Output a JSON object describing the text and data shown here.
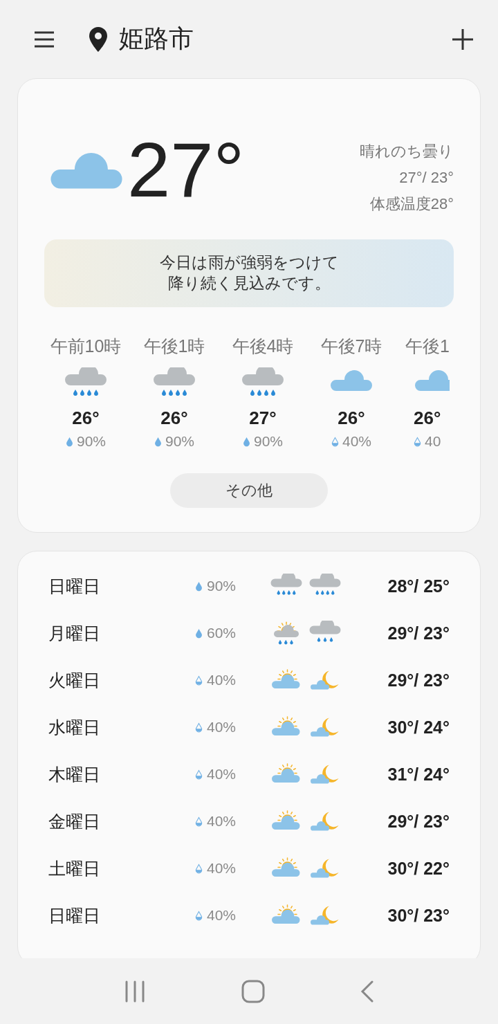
{
  "header": {
    "location": "姫路市"
  },
  "current": {
    "icon": {
      "kind": "cloudy"
    },
    "temperature": "27°",
    "condition": "晴れのち曇り",
    "high_low": "27°/ 23°",
    "feels_like": "体感温度28°",
    "summary_lines": [
      "今日は雨が強弱をつけて",
      "降り続く見込みです。"
    ]
  },
  "hourly": [
    {
      "time": "午前10時",
      "icon": {
        "kind": "rain"
      },
      "temperature": "26°",
      "drop_icon": {
        "kind": "full"
      },
      "precipitation": "90%"
    },
    {
      "time": "午後1時",
      "icon": {
        "kind": "rain"
      },
      "temperature": "26°",
      "drop_icon": {
        "kind": "full"
      },
      "precipitation": "90%"
    },
    {
      "time": "午後4時",
      "icon": {
        "kind": "rain"
      },
      "temperature": "27°",
      "drop_icon": {
        "kind": "full"
      },
      "precipitation": "90%"
    },
    {
      "time": "午後7時",
      "icon": {
        "kind": "cloudy"
      },
      "temperature": "26°",
      "drop_icon": {
        "kind": "half"
      },
      "precipitation": "40%"
    },
    {
      "time": "午後1",
      "icon": {
        "kind": "cloudy"
      },
      "temperature": "26°",
      "drop_icon": {
        "kind": "half"
      },
      "precipitation": "40"
    }
  ],
  "more_button": "その他",
  "daily": [
    {
      "day": "日曜日",
      "drop_icon": {
        "kind": "full"
      },
      "precipitation": "90%",
      "day_icon": {
        "kind": "rain"
      },
      "night_icon": {
        "kind": "rain"
      },
      "temperatures": "28°/ 25°"
    },
    {
      "day": "月曜日",
      "drop_icon": {
        "kind": "full"
      },
      "precipitation": "60%",
      "day_icon": {
        "kind": "sun-rain"
      },
      "night_icon": {
        "kind": "rain-light"
      },
      "temperatures": "29°/ 23°"
    },
    {
      "day": "火曜日",
      "drop_icon": {
        "kind": "half"
      },
      "precipitation": "40%",
      "day_icon": {
        "kind": "sun-cloud"
      },
      "night_icon": {
        "kind": "moon-cloud"
      },
      "temperatures": "29°/ 23°"
    },
    {
      "day": "水曜日",
      "drop_icon": {
        "kind": "half"
      },
      "precipitation": "40%",
      "day_icon": {
        "kind": "sun-cloud"
      },
      "night_icon": {
        "kind": "moon-cloud"
      },
      "temperatures": "30°/ 24°"
    },
    {
      "day": "木曜日",
      "drop_icon": {
        "kind": "half"
      },
      "precipitation": "40%",
      "day_icon": {
        "kind": "sun-cloud"
      },
      "night_icon": {
        "kind": "moon-cloud"
      },
      "temperatures": "31°/ 24°"
    },
    {
      "day": "金曜日",
      "drop_icon": {
        "kind": "half"
      },
      "precipitation": "40%",
      "day_icon": {
        "kind": "sun-cloud"
      },
      "night_icon": {
        "kind": "moon-cloud"
      },
      "temperatures": "29°/ 23°"
    },
    {
      "day": "土曜日",
      "drop_icon": {
        "kind": "half"
      },
      "precipitation": "40%",
      "day_icon": {
        "kind": "sun-cloud"
      },
      "night_icon": {
        "kind": "moon-cloud"
      },
      "temperatures": "30°/ 22°"
    },
    {
      "day": "日曜日",
      "drop_icon": {
        "kind": "half"
      },
      "precipitation": "40%",
      "day_icon": {
        "kind": "sun-cloud"
      },
      "night_icon": {
        "kind": "moon-cloud"
      },
      "temperatures": "30°/ 23°"
    }
  ]
}
